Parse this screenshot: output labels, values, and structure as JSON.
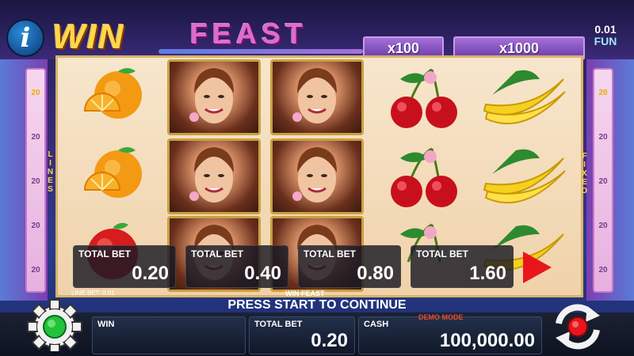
{
  "header": {
    "info_label": "i",
    "logo_win": "WIN",
    "logo_feast": "FEAST",
    "mult_small": "x100",
    "mult_large": "x1000",
    "denom_value": "0.01",
    "denom_currency": "FUN"
  },
  "reels": [
    [
      "orange",
      "orange",
      "apple"
    ],
    [
      "woman",
      "woman",
      "woman"
    ],
    [
      "woman",
      "woman",
      "woman"
    ],
    [
      "cherry",
      "cherry",
      "cherry"
    ],
    [
      "banana",
      "banana",
      "banana"
    ]
  ],
  "side": {
    "left_numbers": [
      "20",
      "20",
      "20",
      "20",
      "20"
    ],
    "right_numbers": [
      "20",
      "20",
      "20",
      "20",
      "20"
    ],
    "left_word": "LINES",
    "right_word": "FIXED"
  },
  "bets": [
    {
      "label": "TOTAL BET",
      "value": "0.20"
    },
    {
      "label": "TOTAL BET",
      "value": "0.40"
    },
    {
      "label": "TOTAL BET",
      "value": "0.80"
    },
    {
      "label": "TOTAL BET",
      "value": "1.60"
    }
  ],
  "line_bet": "LINE BET: 0.01",
  "game_name": "WIN FEAST",
  "press_start": "PRESS START TO CONTINUE",
  "bottom": {
    "win_label": "WIN",
    "win_value": "",
    "total_bet_label": "TOTAL BET",
    "total_bet_value": "0.20",
    "cash_label": "CASH",
    "cash_value": "100,000.00",
    "demo_mode": "DEMO MODE"
  },
  "colors": {
    "accent_gold": "#ffd84a",
    "feast_pink": "#e06ad0",
    "play_red": "#e8161b",
    "start_green": "#22c33a"
  }
}
